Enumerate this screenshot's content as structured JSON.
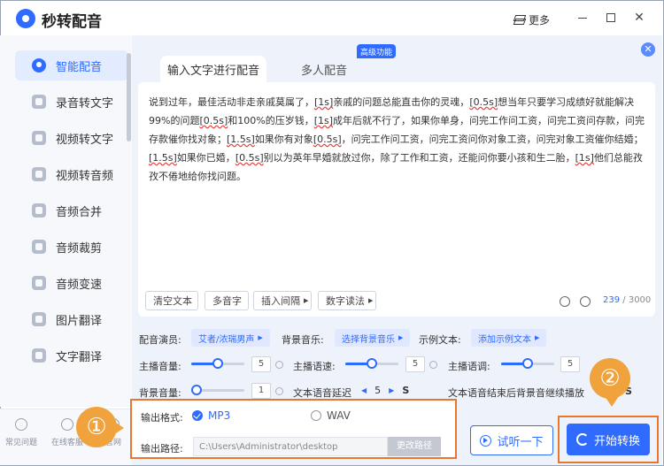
{
  "app": {
    "title": "秒转配音",
    "more_label": "更多"
  },
  "sidebar": {
    "items": [
      {
        "label": "智能配音",
        "icon": "smart-dub-icon"
      },
      {
        "label": "录音转文字",
        "icon": "audio-to-text-icon"
      },
      {
        "label": "视频转文字",
        "icon": "video-to-text-icon"
      },
      {
        "label": "视频转音频",
        "icon": "video-to-audio-icon"
      },
      {
        "label": "音频合并",
        "icon": "audio-merge-icon"
      },
      {
        "label": "音频裁剪",
        "icon": "audio-cut-icon"
      },
      {
        "label": "音频变速",
        "icon": "audio-speed-icon"
      },
      {
        "label": "图片翻译",
        "icon": "image-translate-icon"
      },
      {
        "label": "文字翻译",
        "icon": "text-translate-icon"
      }
    ],
    "footer": [
      {
        "label": "常见问题",
        "icon": "help-icon"
      },
      {
        "label": "在线客服",
        "icon": "service-icon"
      },
      {
        "label": "官网",
        "icon": "web-icon"
      }
    ]
  },
  "tabs": [
    {
      "label": "输入文字进行配音"
    },
    {
      "label": "多人配音"
    }
  ],
  "pro_badge": "高级功能",
  "editor": {
    "segments": [
      "说到过年，最佳活动非走亲戚莫属了，",
      "[1s]",
      "亲戚的问题总能直击你的灵魂，",
      "[0.5s]",
      "想当年只要学习成绩好就能解决99%的问题",
      "[0.5s]",
      "和100%的压岁钱，",
      "[1s]",
      "成年后就不行了，如果你单身，问完工作问工资，问完工资问存款，问完存款催你找对象；",
      "[1.5s]",
      "如果你有对象",
      "[0.5s]",
      "，问完工作问工资，问完工资问你对象工资，问完对象工资催你结婚；",
      "[1.5s]",
      "如果你已婚，",
      "[0.5s]",
      "别以为英年早婚就放过你，除了工作和工资，还能问你要小孩和生二胎，",
      "[1s]",
      "他们总能孜孜不倦地给你找问题。"
    ],
    "tools": {
      "clear": "清空文本",
      "polyphone": "多音字",
      "insert_pause": "插入间隔",
      "digit_read": "数字读法"
    },
    "char_count": "239",
    "char_max": "/ 3000"
  },
  "settings": {
    "voice_label": "配音演员:",
    "voice_value": "艾者/浓瑞男声",
    "bgm_label": "背景音乐:",
    "bgm_value": "选择背景音乐",
    "sample_label": "示例文本:",
    "sample_value": "添加示例文本",
    "host_volume_label": "主播音量:",
    "host_volume": 5,
    "host_speed_label": "主播语速:",
    "host_speed": 5,
    "host_pitch_label": "主播语调:",
    "host_pitch": 5,
    "bg_volume_label": "背景音量:",
    "bg_volume": 1,
    "delay_label": "文本语音延迟",
    "delay_value": "5",
    "delay_unit": "S",
    "tail_label": "文本语音结束后背景音继续播放",
    "tail_unit": "S"
  },
  "output": {
    "format_label": "输出格式:",
    "formats": [
      "MP3",
      "WAV"
    ],
    "selected_format": "MP3",
    "path_label": "输出路径:",
    "path_value": "C:\\Users\\Administrator\\desktop",
    "change_path": "更改路径"
  },
  "actions": {
    "preview": "试听一下",
    "start": "开始转换"
  },
  "annotations": {
    "step1": "①",
    "step2": "②"
  },
  "colors": {
    "accent": "#2f6bff",
    "highlight": "#e8772e",
    "badge": "#f0a23d"
  }
}
